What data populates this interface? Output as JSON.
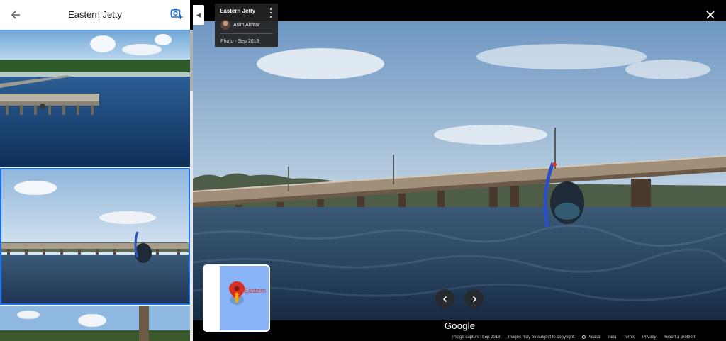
{
  "left_panel": {
    "title": "Eastern Jetty",
    "back_icon": "arrow-left-icon",
    "add_photo_icon": "add-photo-icon",
    "photos": [
      {
        "label": "photo-1"
      },
      {
        "label": "photo-2",
        "selected": true
      },
      {
        "label": "photo-3"
      }
    ]
  },
  "info_card": {
    "title": "Eastern Jetty",
    "author": "Asim Akhtar",
    "date": "Photo - Sep 2018"
  },
  "minimap": {
    "label": "Eastern ."
  },
  "footer": {
    "logo": "Google",
    "capture": "Image capture: Sep 2018",
    "copyright": "Images may be subject to copyright.",
    "picasa": "Picasa",
    "country": "India",
    "terms": "Terms",
    "privacy": "Privacy",
    "report": "Report a problem"
  },
  "colors": {
    "accent": "#1a73e8",
    "pin": "#d93025",
    "card_bg": "#232323"
  }
}
